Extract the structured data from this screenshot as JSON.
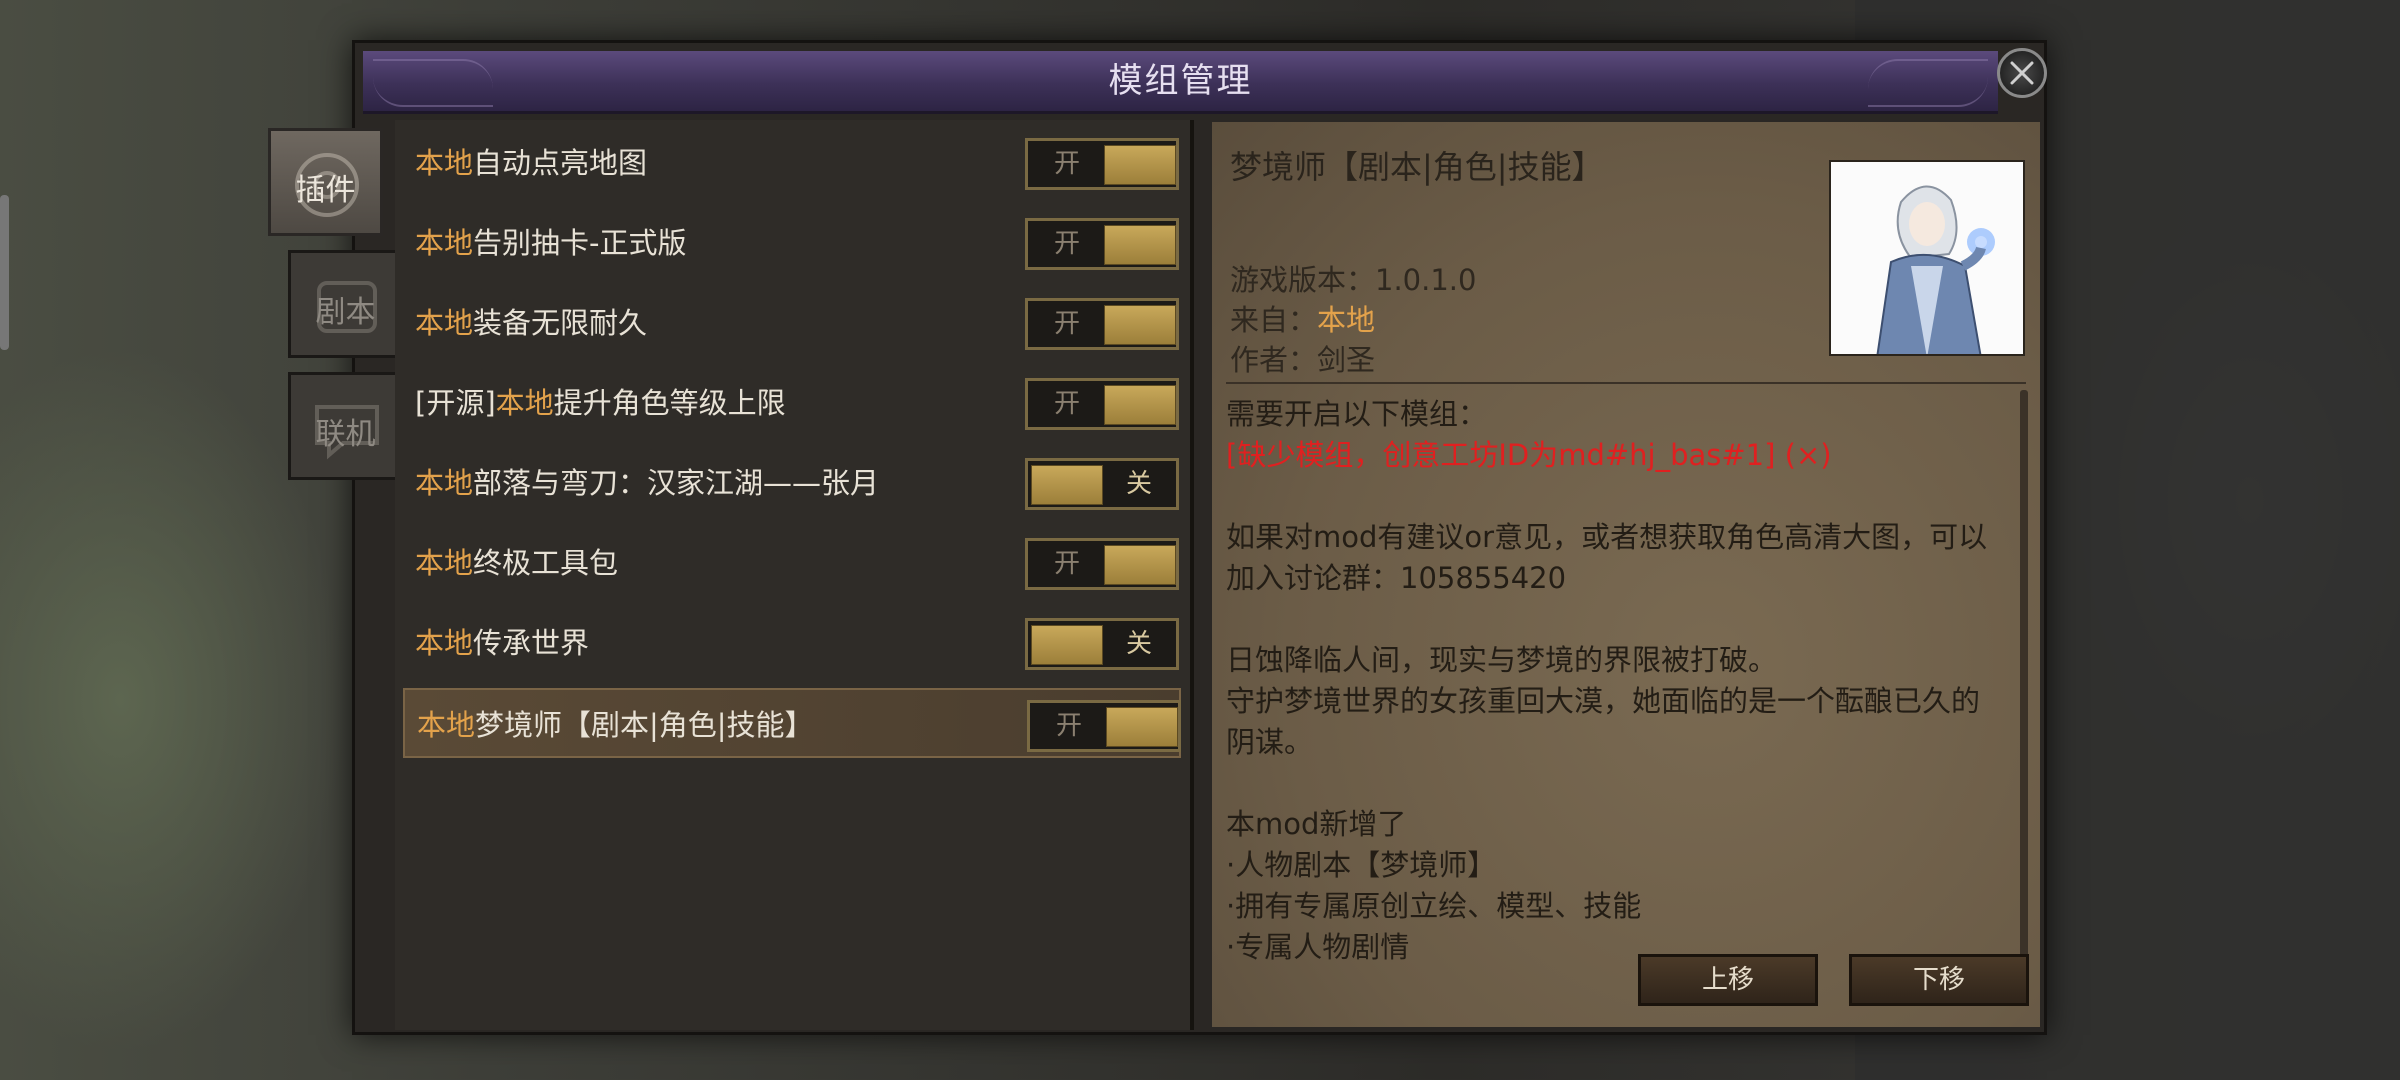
{
  "dialog": {
    "title": "模组管理"
  },
  "tabs": [
    {
      "label": "插件",
      "active": true
    },
    {
      "label": "剧本",
      "active": false
    },
    {
      "label": "联机",
      "active": false
    }
  ],
  "mods": [
    {
      "prefix": "",
      "source": "本地",
      "name": "自动点亮地图",
      "toggle": "开",
      "enabled": true
    },
    {
      "prefix": "",
      "source": "本地",
      "name": "告别抽卡-正式版",
      "toggle": "开",
      "enabled": true
    },
    {
      "prefix": "",
      "source": "本地",
      "name": "装备无限耐久",
      "toggle": "开",
      "enabled": true
    },
    {
      "prefix": "[开源]",
      "source": "本地",
      "name": "提升角色等级上限",
      "toggle": "开",
      "enabled": true
    },
    {
      "prefix": "",
      "source": "本地",
      "name": "部落与弯刀：汉家江湖——张月",
      "toggle": "关",
      "enabled": false
    },
    {
      "prefix": "",
      "source": "本地",
      "name": "终极工具包",
      "toggle": "开",
      "enabled": true
    },
    {
      "prefix": "",
      "source": "本地",
      "name": "传承世界",
      "toggle": "关",
      "enabled": false
    },
    {
      "prefix": "",
      "source": "本地",
      "name": "梦境师【剧本|角色|技能】",
      "toggle": "开",
      "enabled": true,
      "selected": true
    }
  ],
  "detail": {
    "title": "梦境师【剧本|角色|技能】",
    "version_label": "游戏版本：",
    "version": "1.0.1.0",
    "source_label": "来自：",
    "source": "本地",
    "author_label": "作者：",
    "author": "剑圣",
    "requires_label": "需要开启以下模组：",
    "missing": "[缺少模组，创意工坊ID为md#hj_bas#1] (×)",
    "p1": "如果对mod有建议or意见，或者想获取角色高清大图，可以\n加入讨论群：105855420",
    "p2": "日蚀降临人间，现实与梦境的界限被打破。\n守护梦境世界的女孩重回大漠，她面临的是一个酝酿已久的\n阴谋。",
    "p3": "本mod新增了\n·人物剧本【梦境师】\n·拥有专属原创立绘、模型、技能\n·专属人物剧情"
  },
  "buttons": {
    "up": "上移",
    "down": "下移"
  }
}
